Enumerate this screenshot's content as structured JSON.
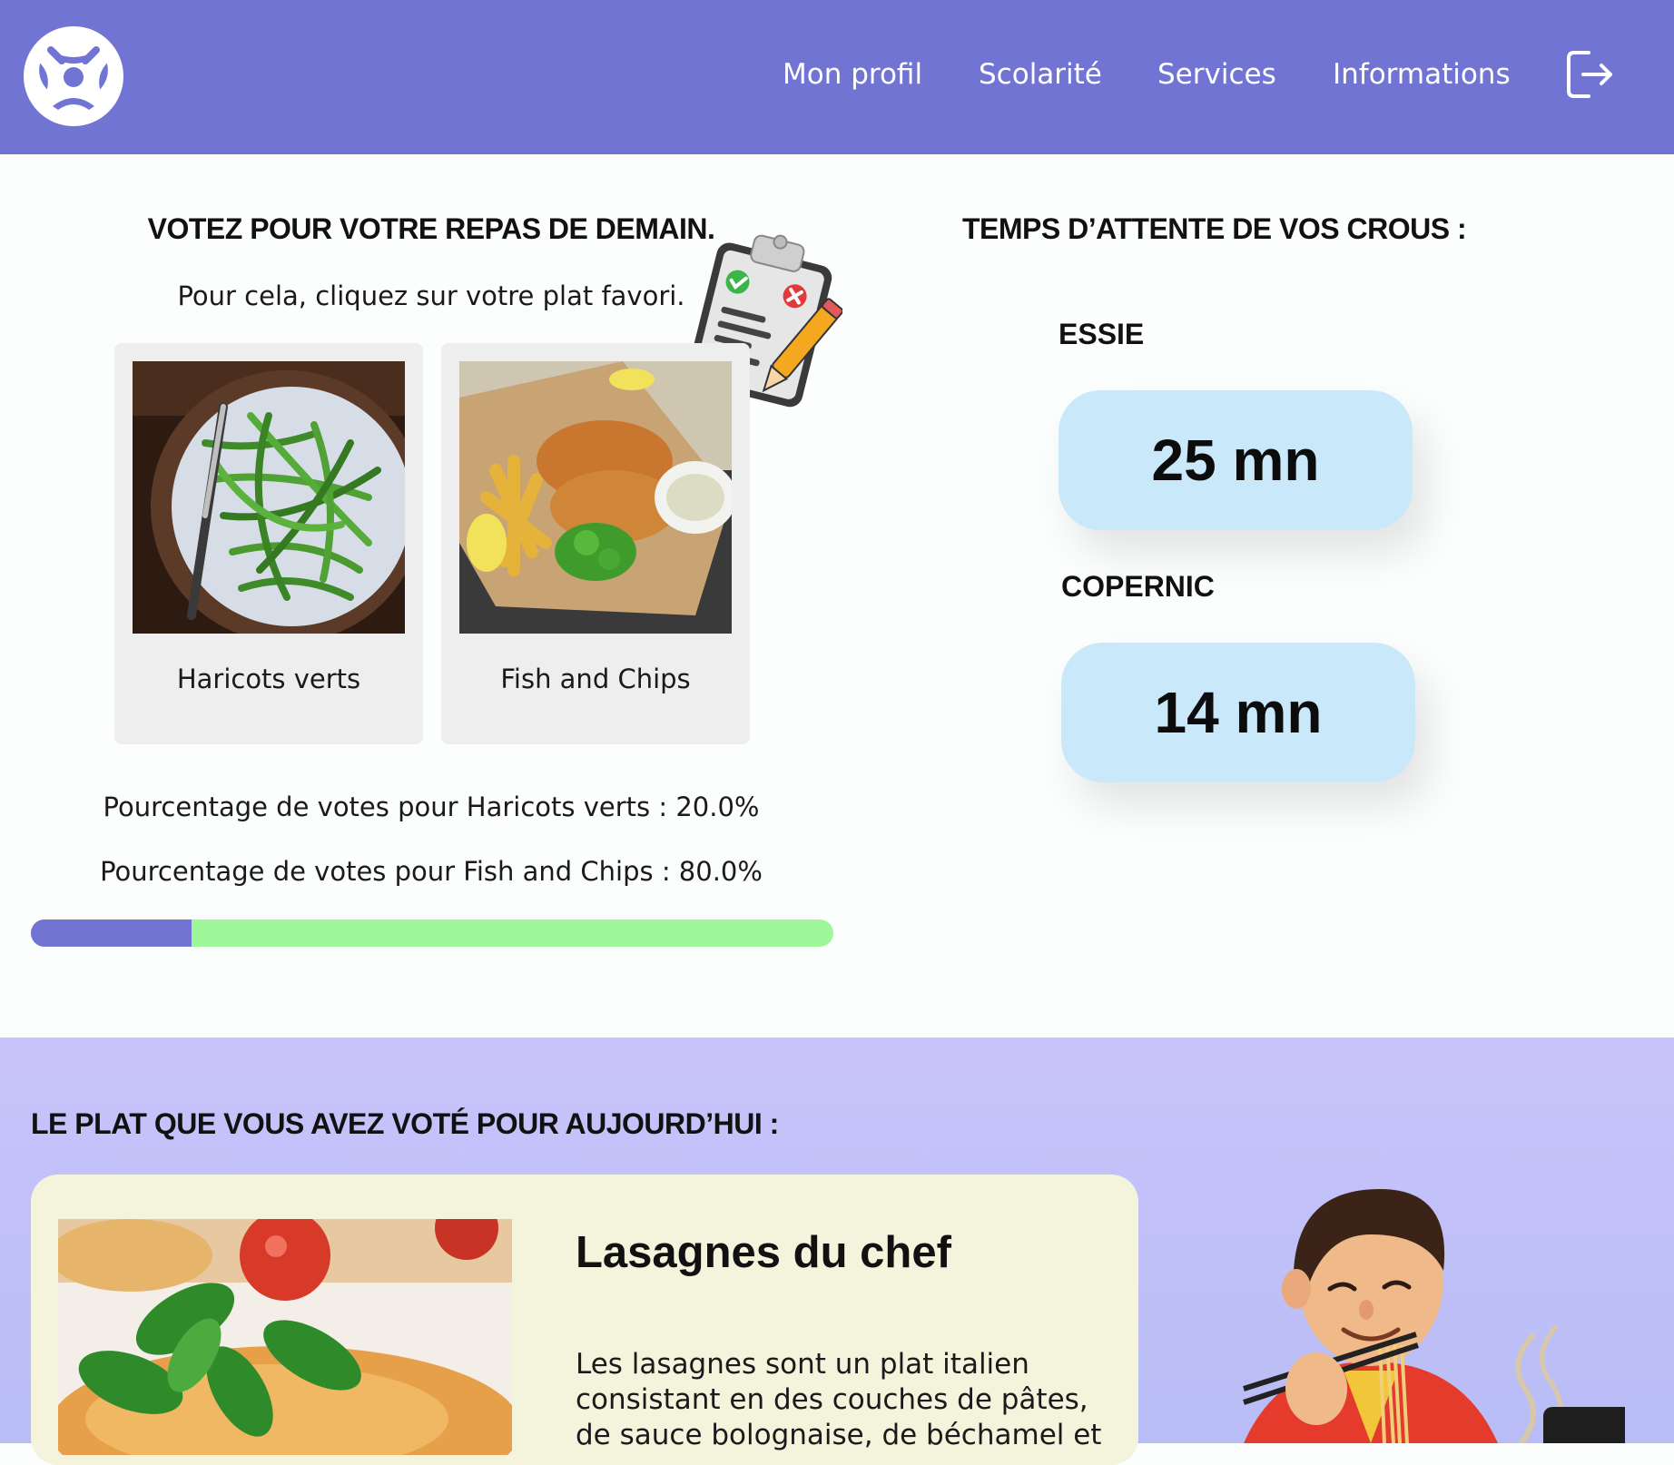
{
  "nav": {
    "items": [
      {
        "label": "Mon profil"
      },
      {
        "label": "Scolarité"
      },
      {
        "label": "Services"
      },
      {
        "label": "Informations"
      }
    ],
    "logout_icon": "logout-icon",
    "logo_icon": "angry-face-logo"
  },
  "vote": {
    "title": "VOTEZ POUR VOTRE REPAS DE DEMAIN.",
    "subtitle": "Pour cela, cliquez sur votre plat favori.",
    "dishes": [
      {
        "name": "Haricots verts"
      },
      {
        "name": "Fish and Chips"
      }
    ],
    "percent_lines": [
      "Pourcentage de votes pour Haricots verts : 20.0%",
      "Pourcentage de votes pour Fish and Chips : 80.0%"
    ],
    "progress_fraction": 0.2,
    "colors": {
      "first": "#7274d4",
      "second": "#a0f79a"
    }
  },
  "wait": {
    "title": "TEMPS D’ATTENTE DE VOS CROUS :",
    "campuses": [
      {
        "name": "ESSIE",
        "time": "25 mn"
      },
      {
        "name": "COPERNIC",
        "time": "14 mn"
      }
    ]
  },
  "today": {
    "title": "LE PLAT QUE VOUS AVEZ VOTÉ POUR AUJOURD’HUI :",
    "meal_name": "Lasagnes du chef",
    "meal_description": "Les lasagnes sont un plat italien consistant en des couches de pâtes, de sauce bolognaise, de béchamel et"
  },
  "theme": {
    "accent": "#7274d4",
    "wait_box": "#c9e8fa",
    "band": "#c8c3fb",
    "card": "#f4f3dc"
  }
}
